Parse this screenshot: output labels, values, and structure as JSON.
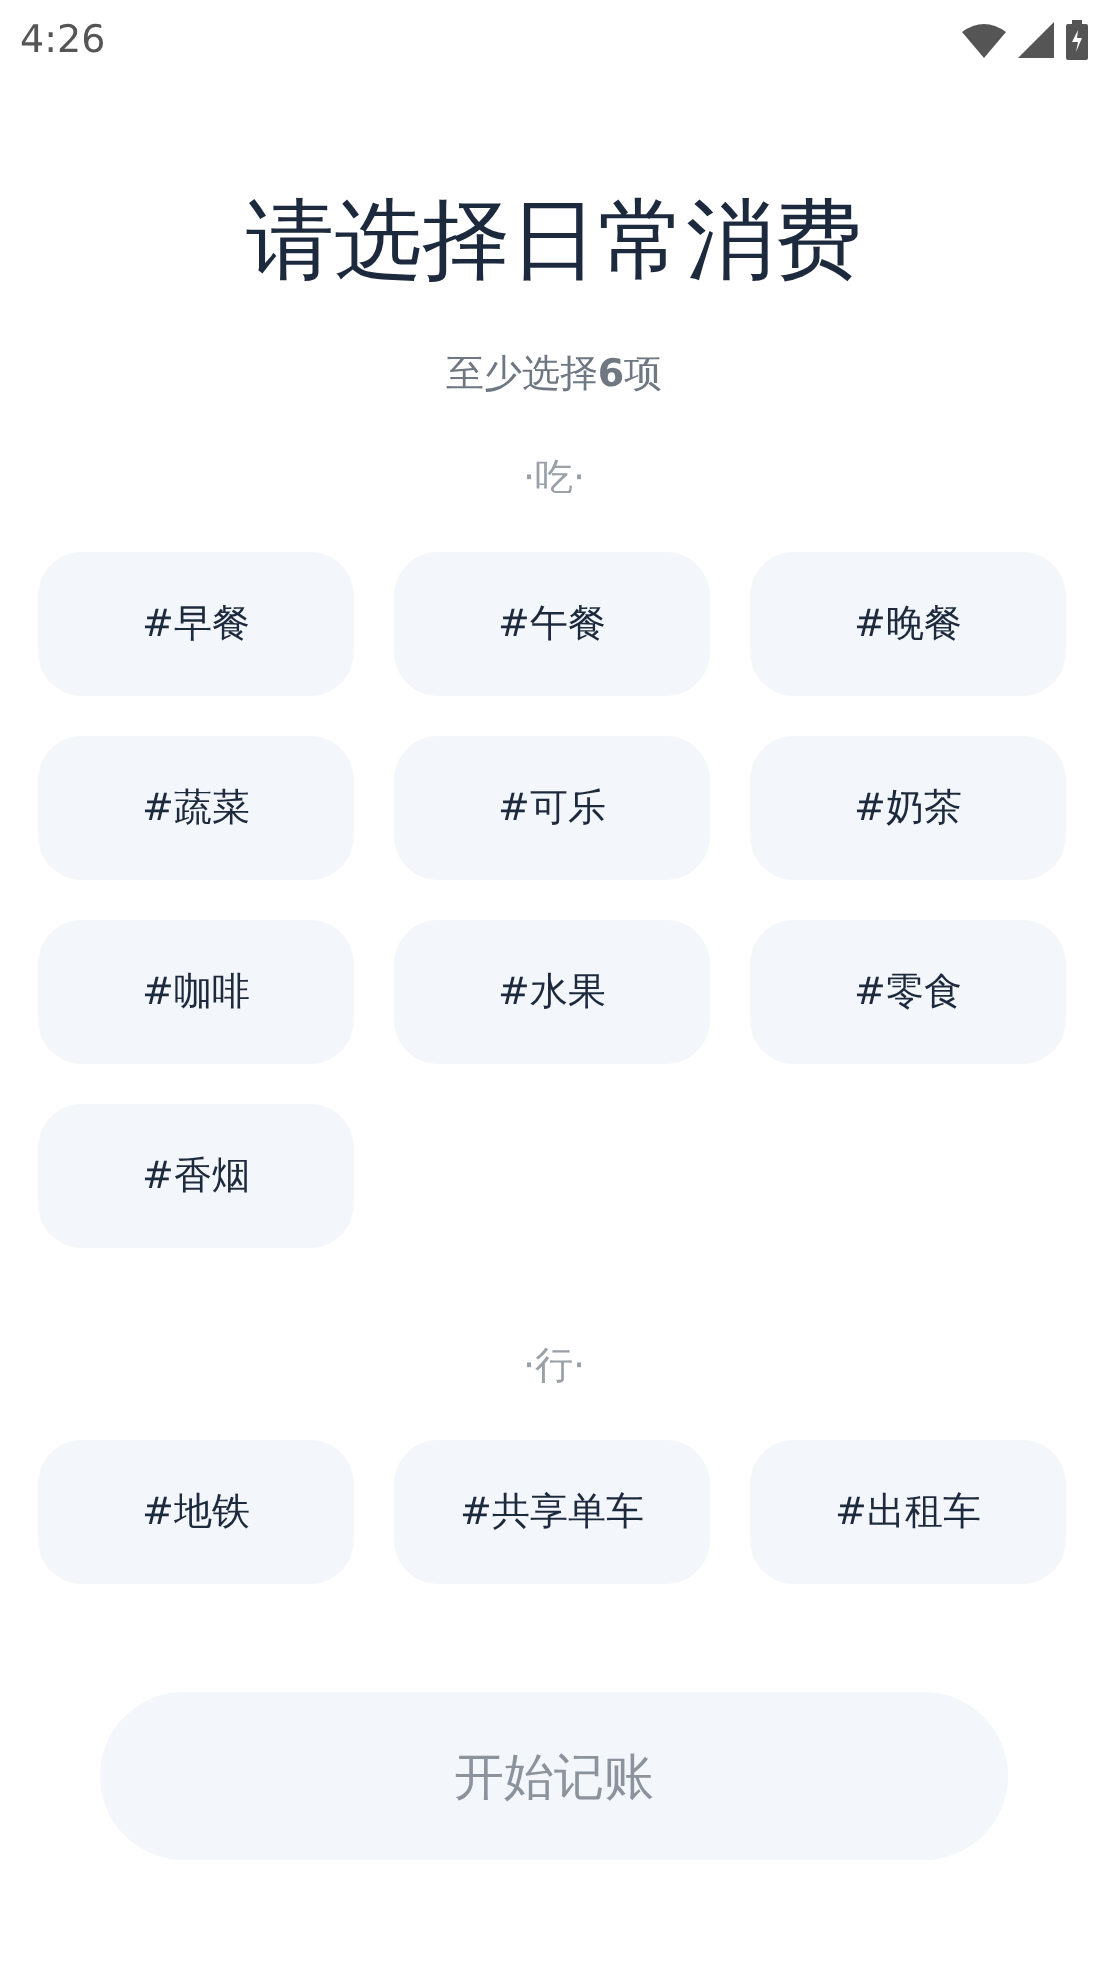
{
  "status_bar": {
    "time": "4:26"
  },
  "title": "请选择日常消费",
  "subtitle": "至少选择**6**项",
  "sections": [
    {
      "label": "·吃·",
      "tags": [
        {
          "label": "#早餐",
          "selected": false
        },
        {
          "label": "#午餐",
          "selected": false
        },
        {
          "label": "#晚餐",
          "selected": false
        },
        {
          "label": "#蔬菜",
          "selected": false
        },
        {
          "label": "#可乐",
          "selected": false
        },
        {
          "label": "#奶茶",
          "selected": false
        },
        {
          "label": "#咖啡",
          "selected": false
        },
        {
          "label": "#水果",
          "selected": false
        },
        {
          "label": "#零食",
          "selected": false
        },
        {
          "label": "#香烟",
          "selected": false
        }
      ]
    },
    {
      "label": "·行·",
      "tags": [
        {
          "label": "#地铁",
          "selected": false
        },
        {
          "label": "#共享单车",
          "selected": false
        },
        {
          "label": "#出租车",
          "selected": false
        }
      ]
    }
  ],
  "start_button": {
    "label": "开始记账",
    "disabled": true
  }
}
